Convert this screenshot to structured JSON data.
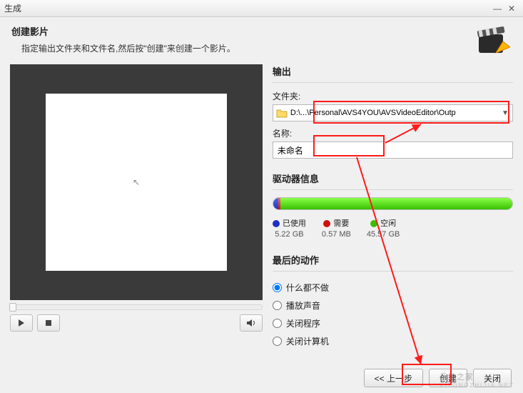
{
  "window": {
    "title": "生成"
  },
  "header": {
    "title": "创建影片",
    "subtitle": "指定输出文件夹和文件名,然后按\"创建\"来创建一个影片。"
  },
  "output": {
    "section": "输出",
    "folder_label": "文件夹:",
    "folder_value": "D:\\...\\Personal\\AVS4YOU\\AVSVideoEditor\\Outp",
    "name_label": "名称:",
    "name_value": "未命名"
  },
  "drive": {
    "section": "驱动器信息",
    "used_label": "已使用",
    "used_value": "5.22 GB",
    "need_label": "需要",
    "need_value": "0.57 MB",
    "free_label": "空闲",
    "free_value": "45.57 GB"
  },
  "final": {
    "section": "最后的动作",
    "options": [
      "什么都不做",
      "播放声音",
      "关闭程序",
      "关闭计算机"
    ],
    "selected": 0
  },
  "footer": {
    "back": "<< 上一步",
    "create": "创建",
    "close": "关闭"
  },
  "watermark": {
    "line1": "系统之家",
    "line2": "XITONGZHIJIA.NET"
  }
}
